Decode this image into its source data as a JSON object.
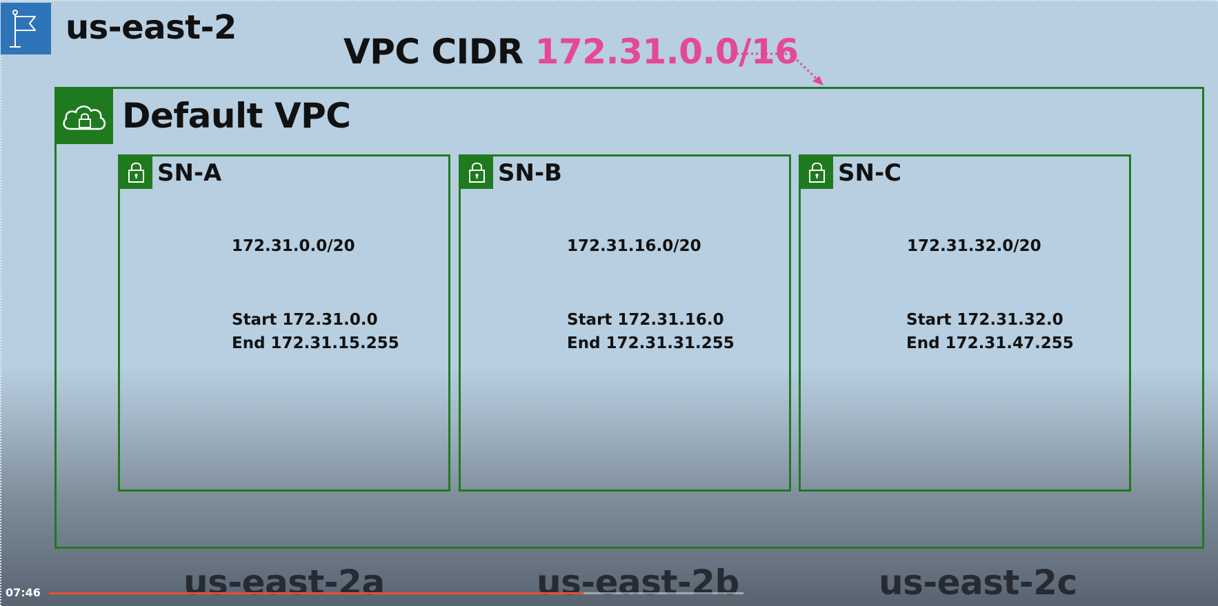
{
  "region": {
    "title": "us-east-2",
    "icon": "flag-icon",
    "icon_bg": "#2e74b8"
  },
  "vpc_cidr": {
    "label": "VPC CIDR",
    "value": "172.31.0.0/16",
    "value_color": "#e54896"
  },
  "vpc": {
    "title": "Default VPC",
    "icon": "cloud-lock-icon",
    "border_color": "#1f7a1f"
  },
  "subnets": [
    {
      "name": "SN-A",
      "cidr": "172.31.0.0/20",
      "start": "Start 172.31.0.0",
      "end": "End 172.31.15.255"
    },
    {
      "name": "SN-B",
      "cidr": "172.31.16.0/20",
      "start": "Start 172.31.16.0",
      "end": "End 172.31.31.255"
    },
    {
      "name": "SN-C",
      "cidr": "172.31.32.0/20",
      "start": "Start 172.31.32.0",
      "end": "End 172.31.47.255"
    }
  ],
  "availability_zones": [
    "us-east-2a",
    "us-east-2b",
    "us-east-2c"
  ],
  "player": {
    "time": "07:46",
    "progress": 0.77,
    "progress_color": "#e8502c"
  }
}
